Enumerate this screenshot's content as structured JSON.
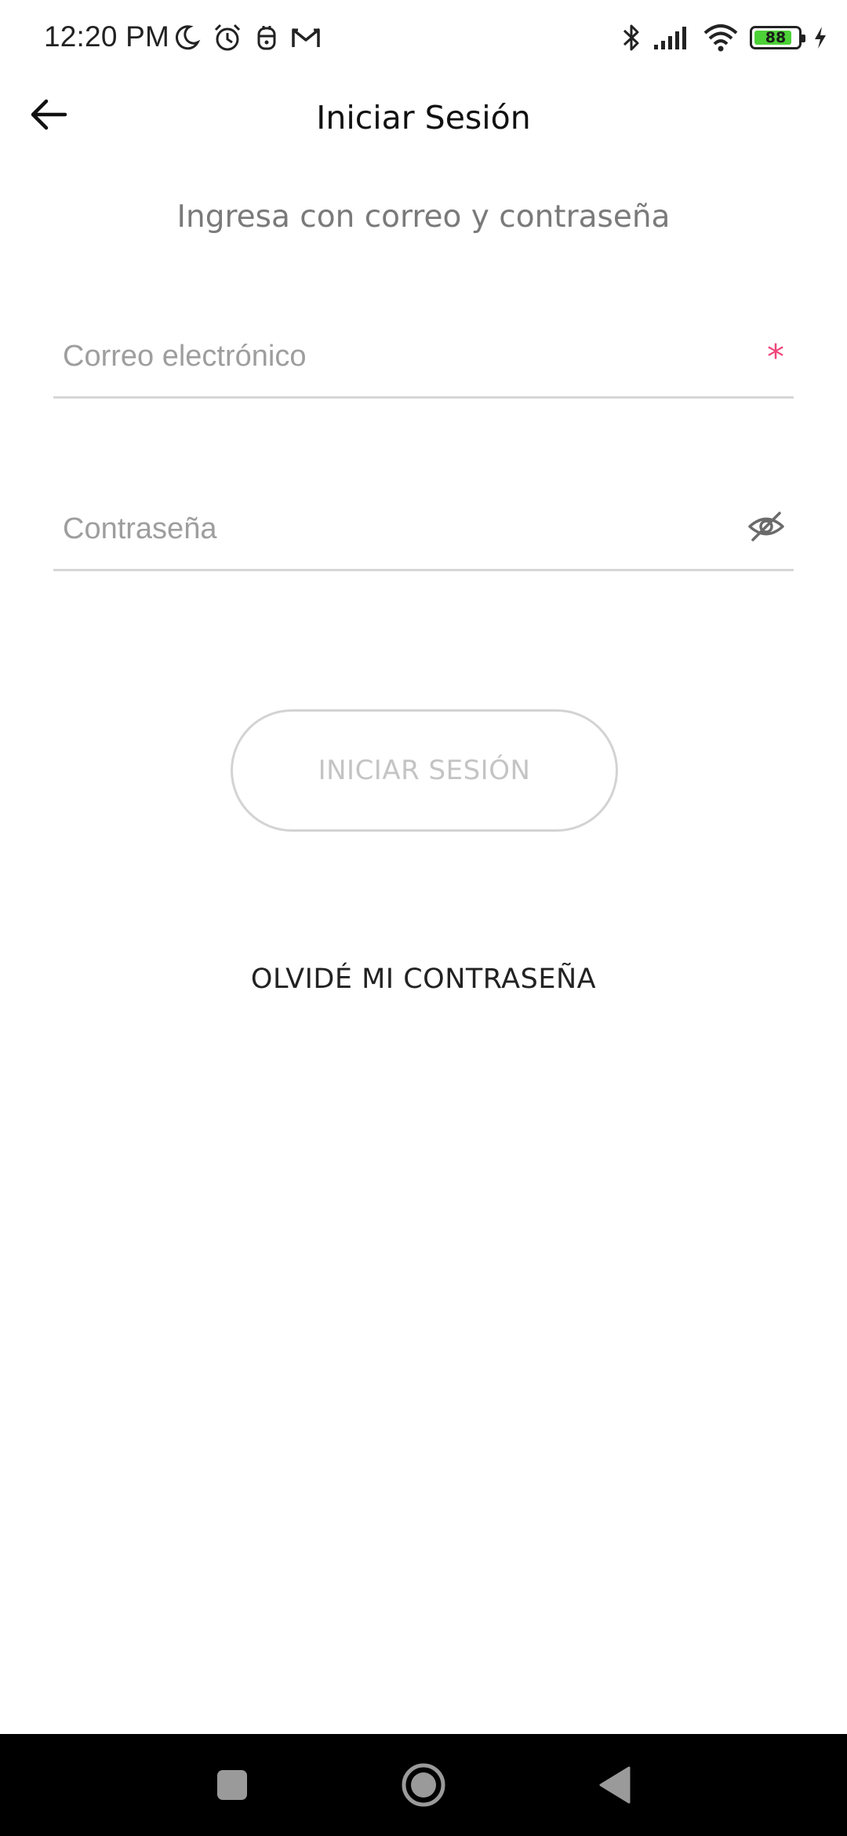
{
  "status_bar": {
    "time": "12:20 PM",
    "battery_level": 88,
    "battery_label": "88",
    "battery_color": "#4cd137",
    "left_icons": [
      "moon-icon",
      "alarm-icon",
      "app-notification-icon",
      "gmail-icon"
    ],
    "right_icons": [
      "bluetooth-icon",
      "signal-icon",
      "wifi-icon",
      "battery-icon",
      "charging-icon"
    ]
  },
  "header": {
    "title": "Iniciar Sesión"
  },
  "subtitle": "Ingresa con correo y contraseña",
  "form": {
    "email": {
      "placeholder": "Correo electrónico",
      "value": "",
      "required_mark": "*"
    },
    "password": {
      "placeholder": "Contraseña",
      "value": ""
    }
  },
  "buttons": {
    "login_label": "INICIAR SESIÓN",
    "forgot_label": "OLVIDÉ MI CONTRASEÑA"
  },
  "colors": {
    "required": "#f0457a",
    "placeholder": "#9e9e9e",
    "disabled_button": "#c4c4c4"
  }
}
